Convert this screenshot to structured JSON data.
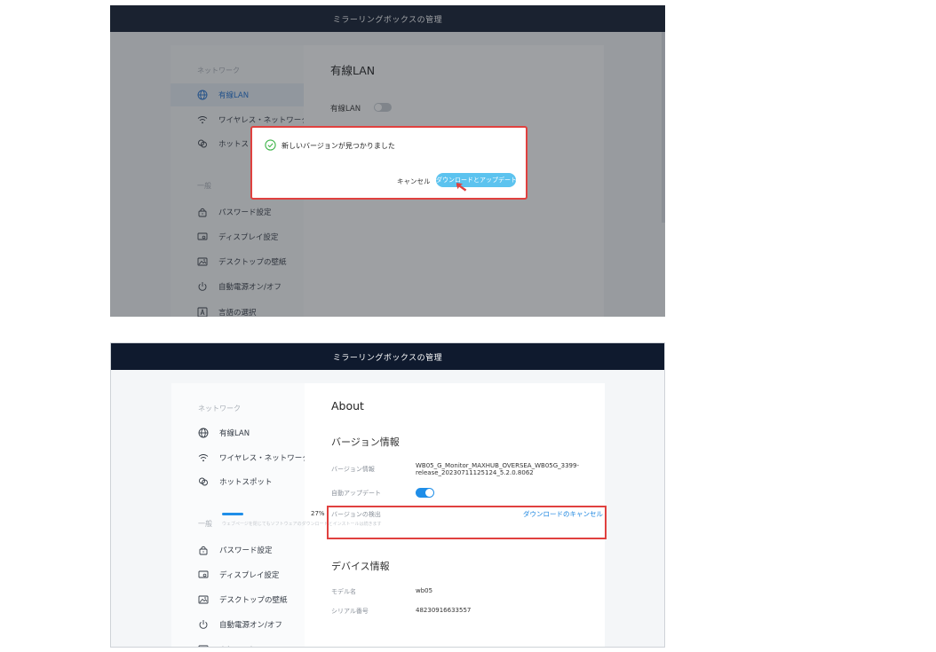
{
  "app": {
    "title": "ミラーリングボックスの管理"
  },
  "sidebar": {
    "network_label": "ネットワーク",
    "general_label": "一般",
    "items": [
      {
        "label": "有線LAN",
        "icon": "globe-icon"
      },
      {
        "label": "ワイヤレス・ネットワーク",
        "icon": "wifi-icon"
      },
      {
        "label": "ホットスポット",
        "icon": "hotspot-icon"
      },
      {
        "label": "パスワード設定",
        "icon": "lock-icon"
      },
      {
        "label": "ディスプレイ設定",
        "icon": "display-icon"
      },
      {
        "label": "デスクトップの壁紙",
        "icon": "wallpaper-icon"
      },
      {
        "label": "自動電源オン/オフ",
        "icon": "power-icon"
      },
      {
        "label": "言語の選択",
        "icon": "language-icon"
      }
    ],
    "hotspot_truncated": "ホットス"
  },
  "wired_page": {
    "title": "有線LAN",
    "toggle_label": "有線LAN",
    "toggle_on": false
  },
  "dialog": {
    "message": "新しいバージョンが見つかりました",
    "cancel_label": "キャンセル",
    "confirm_label": "ダウンロードとアップデート",
    "accent": "#5cc3ef"
  },
  "about": {
    "title": "About",
    "version_section": "バージョン情報",
    "version_label": "バージョン情報",
    "version_value_line1": "WB05_G_Monitor_MAXHUB_OVERSEA_WB05G_3399-",
    "version_value_line2": "release_20230711125124_5.2.0.8062",
    "auto_update_label": "自動アップデート",
    "auto_update_on": true,
    "detect_label": "バージョンの検出",
    "progress_percent": 27,
    "progress_text": "27%",
    "cancel_download_label": "ダウンロードのキャンセル",
    "hint_text": "ウェブページを閉じてもソフトウェアのダウンロードとインストールは続きます",
    "device_section": "デバイス情報",
    "model_label": "モデル名",
    "model_value": "wb05",
    "serial_label": "シリアル番号",
    "serial_value": "48230916633557"
  },
  "colors": {
    "titlebar": "#0f1a2e",
    "accent_blue": "#1f8ee8",
    "highlight_red": "#e0413f"
  }
}
